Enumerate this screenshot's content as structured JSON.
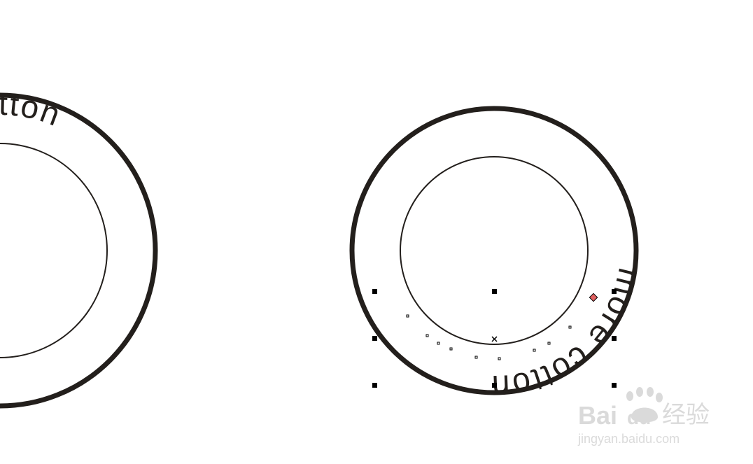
{
  "canvas": {
    "background": "#ffffff",
    "stroke_color": "#231f1c"
  },
  "left_design": {
    "curved_text": "cotton"
  },
  "right_design": {
    "curved_text": "more cotton",
    "selection_handle_color": "#000000",
    "path_start_marker_color": "#e06060"
  },
  "watermark": {
    "brand_latin_start": "Bai",
    "brand_latin_end": "du",
    "brand_chinese": "经验",
    "url": "jingyan.baidu.com"
  }
}
